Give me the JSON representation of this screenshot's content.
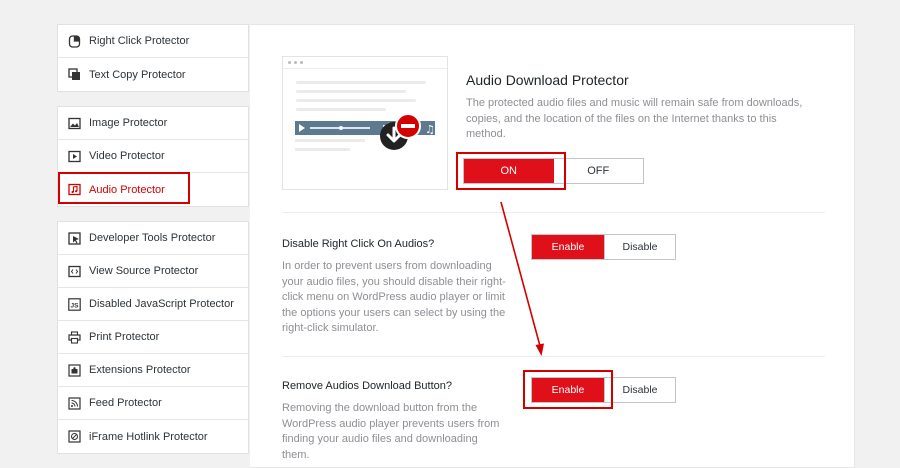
{
  "sidebar": {
    "group1": [
      {
        "label": "Right Click Protector",
        "icon": "mouse-icon"
      },
      {
        "label": "Text Copy Protector",
        "icon": "copy-icon"
      }
    ],
    "group2": [
      {
        "label": "Image Protector",
        "icon": "image-icon"
      },
      {
        "label": "Video Protector",
        "icon": "video-icon"
      },
      {
        "label": "Audio Protector",
        "icon": "audio-icon"
      }
    ],
    "group3": [
      {
        "label": "Developer Tools Protector",
        "icon": "cursor-icon"
      },
      {
        "label": "View Source Protector",
        "icon": "code-icon"
      },
      {
        "label": "Disabled JavaScript Protector",
        "icon": "js-icon"
      },
      {
        "label": "Print Protector",
        "icon": "printer-icon"
      },
      {
        "label": "Extensions Protector",
        "icon": "puzzle-icon"
      },
      {
        "label": "Feed Protector",
        "icon": "rss-icon"
      },
      {
        "label": "iFrame Hotlink Protector",
        "icon": "link-icon"
      }
    ],
    "active": "Audio Protector"
  },
  "main": {
    "title": "Audio Download Protector",
    "description": "The protected audio files and music will remain safe from downloads, copies, and the location of the files on the Internet thanks to this method.",
    "toggle": {
      "on": "ON",
      "off": "OFF",
      "value": "ON"
    },
    "options": [
      {
        "title": "Disable Right Click On Audios?",
        "description": "In order to prevent users from downloading your audio files, you should disable their right-click menu on WordPress audio player or limit the options your users can select by using the right-click simulator.",
        "enable": "Enable",
        "disable": "Disable",
        "value": "Enable"
      },
      {
        "title": "Remove Audios Download Button?",
        "description": "Removing the download button from the WordPress audio player prevents users from finding your audio files and downloading them.",
        "enable": "Enable",
        "disable": "Disable",
        "value": "Enable"
      }
    ]
  },
  "colors": {
    "accent": "#e0101a",
    "annotation": "#d40000"
  }
}
